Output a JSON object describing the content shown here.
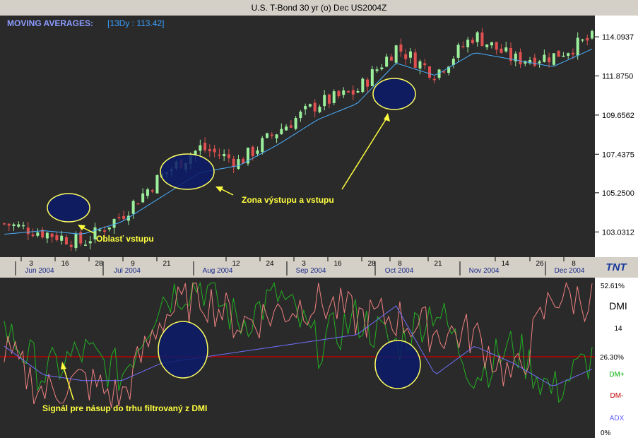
{
  "window": {
    "title": "U.S. T-Bond 30 yr (o) Dec US2004Z"
  },
  "indicator": {
    "label": "MOVING AVERAGES:",
    "value": "[13Dy : 113.42]"
  },
  "price_axis": {
    "ticks": [
      "114.0937",
      "111.8750",
      "109.6562",
      "107.4375",
      "105.2500",
      "103.0312"
    ]
  },
  "date_axis": {
    "day_ticks": [
      "3",
      "16",
      "28",
      "9",
      "21",
      "12",
      "24",
      "3",
      "16",
      "28",
      "8",
      "21",
      "14",
      "26",
      "8"
    ],
    "month_labels": [
      "Jun 2004",
      "Jul 2004",
      "Aug 2004",
      "Sep 2004",
      "Oct 2004",
      "Nov 2004",
      "Dec 2004"
    ]
  },
  "logo": {
    "text": "TNT"
  },
  "dmi_panel": {
    "title": "DMI",
    "period": "14",
    "axis": {
      "top": "52.61%",
      "mid": "26.30%",
      "bottom": "0%"
    },
    "legend": [
      {
        "label": "DM+",
        "color": "#00b000"
      },
      {
        "label": "DM-",
        "color": "#c00000"
      },
      {
        "label": "ADX",
        "color": "#6060ff"
      }
    ]
  },
  "annotations": {
    "entry_area": "Oblasť vstupu",
    "exit_entry_zone": "Zona výstupu a vstupu",
    "signal": "Signál pre násup do trhu filtrovaný z DMI"
  },
  "colors": {
    "bull": "#9cf09c",
    "bear": "#e05050",
    "ma": "#4ab0ff",
    "circle": "#0a1a6a",
    "circle_edge": "#ffff60",
    "annot": "#ffff40"
  },
  "chart_data": [
    {
      "type": "candlestick",
      "title": "U.S. T-Bond 30 yr (o) Dec US2004Z",
      "moving_average_period": 13,
      "last_ma_value": 113.42,
      "ylim": [
        101.6,
        115.3
      ],
      "x": [
        "2004-05-28",
        "2004-06-03",
        "2004-06-16",
        "2004-06-28",
        "2004-07-09",
        "2004-07-21",
        "2004-08-12",
        "2004-08-24",
        "2004-09-03",
        "2004-09-16",
        "2004-09-28",
        "2004-10-08",
        "2004-10-21",
        "2004-11-14",
        "2004-11-26",
        "2004-12-08"
      ],
      "close_approx": [
        103.5,
        103.0,
        102.4,
        104.0,
        106.2,
        107.8,
        107.0,
        108.8,
        110.3,
        111.0,
        113.5,
        112.0,
        114.2,
        112.8,
        113.0,
        114.0
      ],
      "moving_average_approx": [
        102.9,
        103.1,
        102.9,
        103.6,
        105.0,
        106.4,
        106.8,
        108.0,
        109.4,
        110.3,
        112.6,
        111.9,
        113.2,
        112.8,
        112.4,
        113.4
      ]
    },
    {
      "type": "line",
      "title": "DMI",
      "period": 14,
      "ylim": [
        0,
        52.61
      ],
      "series": [
        {
          "name": "DM+",
          "values": [
            36,
            20,
            28,
            20,
            47,
            52,
            38,
            48,
            30,
            40,
            30,
            44,
            20,
            30,
            14,
            26
          ]
        },
        {
          "name": "DM-",
          "values": [
            28,
            14,
            18,
            12,
            40,
            48,
            38,
            42,
            46,
            40,
            40,
            35,
            34,
            18,
            48,
            46
          ]
        },
        {
          "name": "ADX",
          "values": [
            30,
            20,
            18,
            18,
            24,
            26,
            28,
            30,
            32,
            34,
            44,
            20,
            30,
            24,
            16,
            22
          ]
        }
      ]
    }
  ]
}
